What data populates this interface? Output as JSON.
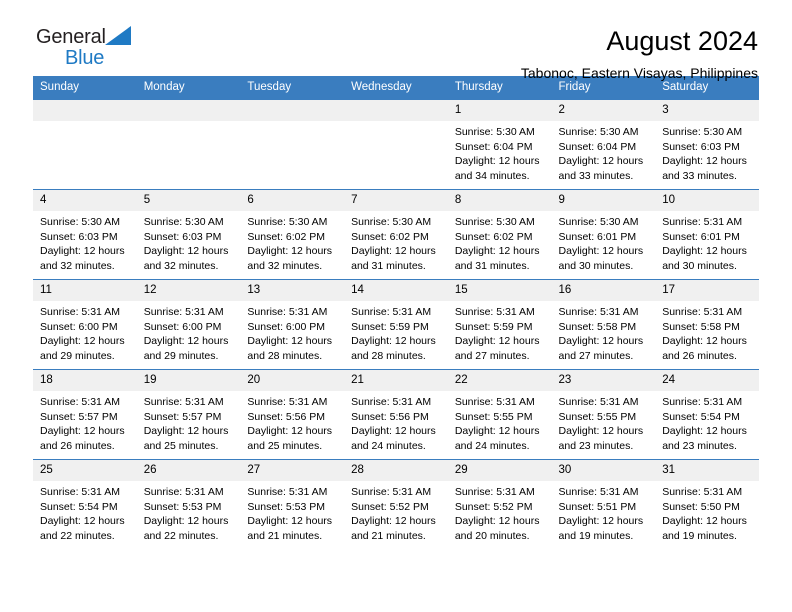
{
  "brand": {
    "line1": "General",
    "line2": "Blue",
    "triangle_color": "#1f7ac4",
    "text_color": "#231f20"
  },
  "header": {
    "title": "August 2024",
    "subtitle": "Tabonoc, Eastern Visayas, Philippines"
  },
  "theme": {
    "header_blue": "#3a7dbf",
    "daynum_bg": "#f0f0f0",
    "cell_bg": "#ffffff"
  },
  "weekdays": [
    "Sunday",
    "Monday",
    "Tuesday",
    "Wednesday",
    "Thursday",
    "Friday",
    "Saturday"
  ],
  "weeks": [
    [
      {
        "day": "",
        "sunrise": "",
        "sunset": "",
        "daylight1": "",
        "daylight2": ""
      },
      {
        "day": "",
        "sunrise": "",
        "sunset": "",
        "daylight1": "",
        "daylight2": ""
      },
      {
        "day": "",
        "sunrise": "",
        "sunset": "",
        "daylight1": "",
        "daylight2": ""
      },
      {
        "day": "",
        "sunrise": "",
        "sunset": "",
        "daylight1": "",
        "daylight2": ""
      },
      {
        "day": "1",
        "sunrise": "Sunrise: 5:30 AM",
        "sunset": "Sunset: 6:04 PM",
        "daylight1": "Daylight: 12 hours",
        "daylight2": "and 34 minutes."
      },
      {
        "day": "2",
        "sunrise": "Sunrise: 5:30 AM",
        "sunset": "Sunset: 6:04 PM",
        "daylight1": "Daylight: 12 hours",
        "daylight2": "and 33 minutes."
      },
      {
        "day": "3",
        "sunrise": "Sunrise: 5:30 AM",
        "sunset": "Sunset: 6:03 PM",
        "daylight1": "Daylight: 12 hours",
        "daylight2": "and 33 minutes."
      }
    ],
    [
      {
        "day": "4",
        "sunrise": "Sunrise: 5:30 AM",
        "sunset": "Sunset: 6:03 PM",
        "daylight1": "Daylight: 12 hours",
        "daylight2": "and 32 minutes."
      },
      {
        "day": "5",
        "sunrise": "Sunrise: 5:30 AM",
        "sunset": "Sunset: 6:03 PM",
        "daylight1": "Daylight: 12 hours",
        "daylight2": "and 32 minutes."
      },
      {
        "day": "6",
        "sunrise": "Sunrise: 5:30 AM",
        "sunset": "Sunset: 6:02 PM",
        "daylight1": "Daylight: 12 hours",
        "daylight2": "and 32 minutes."
      },
      {
        "day": "7",
        "sunrise": "Sunrise: 5:30 AM",
        "sunset": "Sunset: 6:02 PM",
        "daylight1": "Daylight: 12 hours",
        "daylight2": "and 31 minutes."
      },
      {
        "day": "8",
        "sunrise": "Sunrise: 5:30 AM",
        "sunset": "Sunset: 6:02 PM",
        "daylight1": "Daylight: 12 hours",
        "daylight2": "and 31 minutes."
      },
      {
        "day": "9",
        "sunrise": "Sunrise: 5:30 AM",
        "sunset": "Sunset: 6:01 PM",
        "daylight1": "Daylight: 12 hours",
        "daylight2": "and 30 minutes."
      },
      {
        "day": "10",
        "sunrise": "Sunrise: 5:31 AM",
        "sunset": "Sunset: 6:01 PM",
        "daylight1": "Daylight: 12 hours",
        "daylight2": "and 30 minutes."
      }
    ],
    [
      {
        "day": "11",
        "sunrise": "Sunrise: 5:31 AM",
        "sunset": "Sunset: 6:00 PM",
        "daylight1": "Daylight: 12 hours",
        "daylight2": "and 29 minutes."
      },
      {
        "day": "12",
        "sunrise": "Sunrise: 5:31 AM",
        "sunset": "Sunset: 6:00 PM",
        "daylight1": "Daylight: 12 hours",
        "daylight2": "and 29 minutes."
      },
      {
        "day": "13",
        "sunrise": "Sunrise: 5:31 AM",
        "sunset": "Sunset: 6:00 PM",
        "daylight1": "Daylight: 12 hours",
        "daylight2": "and 28 minutes."
      },
      {
        "day": "14",
        "sunrise": "Sunrise: 5:31 AM",
        "sunset": "Sunset: 5:59 PM",
        "daylight1": "Daylight: 12 hours",
        "daylight2": "and 28 minutes."
      },
      {
        "day": "15",
        "sunrise": "Sunrise: 5:31 AM",
        "sunset": "Sunset: 5:59 PM",
        "daylight1": "Daylight: 12 hours",
        "daylight2": "and 27 minutes."
      },
      {
        "day": "16",
        "sunrise": "Sunrise: 5:31 AM",
        "sunset": "Sunset: 5:58 PM",
        "daylight1": "Daylight: 12 hours",
        "daylight2": "and 27 minutes."
      },
      {
        "day": "17",
        "sunrise": "Sunrise: 5:31 AM",
        "sunset": "Sunset: 5:58 PM",
        "daylight1": "Daylight: 12 hours",
        "daylight2": "and 26 minutes."
      }
    ],
    [
      {
        "day": "18",
        "sunrise": "Sunrise: 5:31 AM",
        "sunset": "Sunset: 5:57 PM",
        "daylight1": "Daylight: 12 hours",
        "daylight2": "and 26 minutes."
      },
      {
        "day": "19",
        "sunrise": "Sunrise: 5:31 AM",
        "sunset": "Sunset: 5:57 PM",
        "daylight1": "Daylight: 12 hours",
        "daylight2": "and 25 minutes."
      },
      {
        "day": "20",
        "sunrise": "Sunrise: 5:31 AM",
        "sunset": "Sunset: 5:56 PM",
        "daylight1": "Daylight: 12 hours",
        "daylight2": "and 25 minutes."
      },
      {
        "day": "21",
        "sunrise": "Sunrise: 5:31 AM",
        "sunset": "Sunset: 5:56 PM",
        "daylight1": "Daylight: 12 hours",
        "daylight2": "and 24 minutes."
      },
      {
        "day": "22",
        "sunrise": "Sunrise: 5:31 AM",
        "sunset": "Sunset: 5:55 PM",
        "daylight1": "Daylight: 12 hours",
        "daylight2": "and 24 minutes."
      },
      {
        "day": "23",
        "sunrise": "Sunrise: 5:31 AM",
        "sunset": "Sunset: 5:55 PM",
        "daylight1": "Daylight: 12 hours",
        "daylight2": "and 23 minutes."
      },
      {
        "day": "24",
        "sunrise": "Sunrise: 5:31 AM",
        "sunset": "Sunset: 5:54 PM",
        "daylight1": "Daylight: 12 hours",
        "daylight2": "and 23 minutes."
      }
    ],
    [
      {
        "day": "25",
        "sunrise": "Sunrise: 5:31 AM",
        "sunset": "Sunset: 5:54 PM",
        "daylight1": "Daylight: 12 hours",
        "daylight2": "and 22 minutes."
      },
      {
        "day": "26",
        "sunrise": "Sunrise: 5:31 AM",
        "sunset": "Sunset: 5:53 PM",
        "daylight1": "Daylight: 12 hours",
        "daylight2": "and 22 minutes."
      },
      {
        "day": "27",
        "sunrise": "Sunrise: 5:31 AM",
        "sunset": "Sunset: 5:53 PM",
        "daylight1": "Daylight: 12 hours",
        "daylight2": "and 21 minutes."
      },
      {
        "day": "28",
        "sunrise": "Sunrise: 5:31 AM",
        "sunset": "Sunset: 5:52 PM",
        "daylight1": "Daylight: 12 hours",
        "daylight2": "and 21 minutes."
      },
      {
        "day": "29",
        "sunrise": "Sunrise: 5:31 AM",
        "sunset": "Sunset: 5:52 PM",
        "daylight1": "Daylight: 12 hours",
        "daylight2": "and 20 minutes."
      },
      {
        "day": "30",
        "sunrise": "Sunrise: 5:31 AM",
        "sunset": "Sunset: 5:51 PM",
        "daylight1": "Daylight: 12 hours",
        "daylight2": "and 19 minutes."
      },
      {
        "day": "31",
        "sunrise": "Sunrise: 5:31 AM",
        "sunset": "Sunset: 5:50 PM",
        "daylight1": "Daylight: 12 hours",
        "daylight2": "and 19 minutes."
      }
    ]
  ]
}
